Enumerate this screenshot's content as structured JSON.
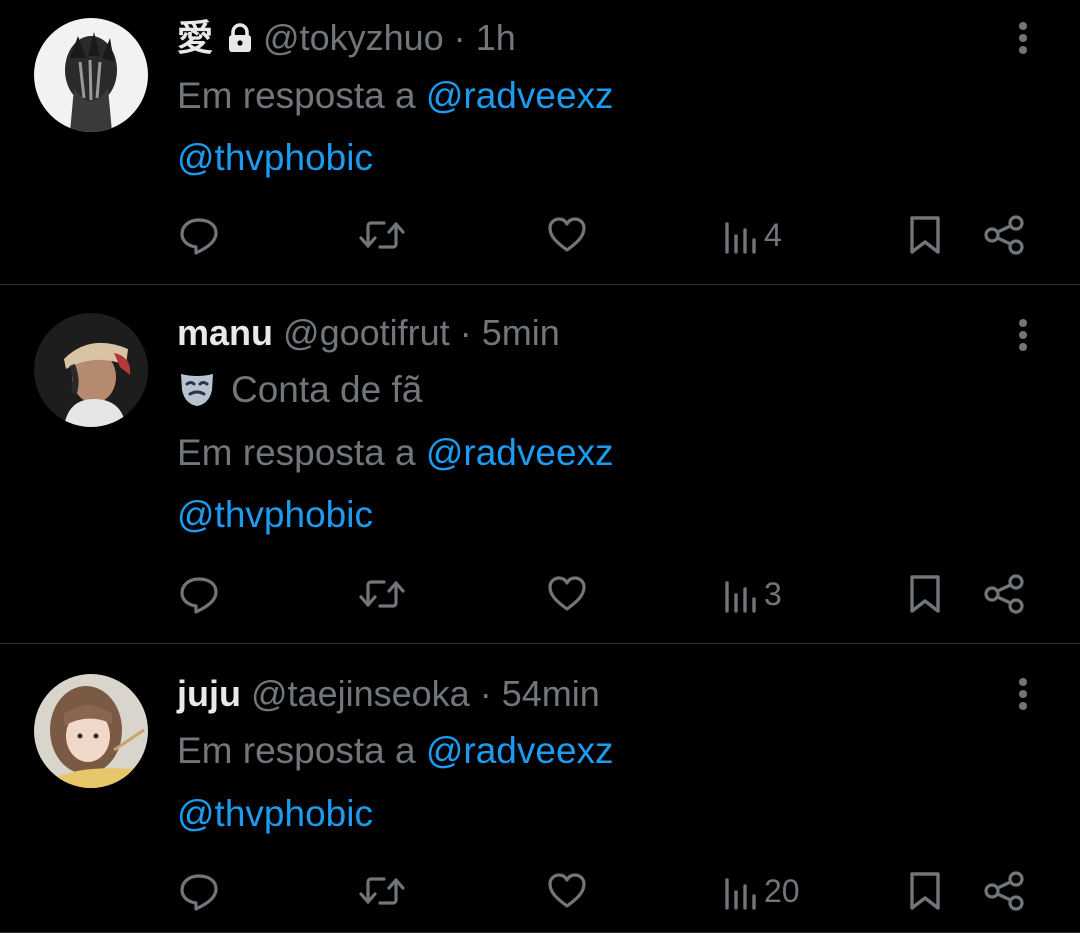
{
  "colors": {
    "background": "#000000",
    "text": "#e7e9ea",
    "muted": "#71767b",
    "link": "#1d9bf0",
    "divider": "#2f3336"
  },
  "reply_prefix": "Em resposta a",
  "tweets": [
    {
      "display_name": "愛",
      "protected": true,
      "handle": "@tokyzhuo",
      "separator": "·",
      "time": "1h",
      "badge": null,
      "reply_to": "@radveexz",
      "text": "@thvphobic",
      "views": "4",
      "icons": [
        "reply-icon",
        "retweet-icon",
        "like-icon",
        "views-icon",
        "bookmark-icon",
        "share-icon",
        "more-icon"
      ]
    },
    {
      "display_name": "manu",
      "protected": false,
      "handle": "@gootifrut",
      "separator": "·",
      "time": "5min",
      "badge": "Conta de fã",
      "reply_to": "@radveexz",
      "text": "@thvphobic",
      "views": "3",
      "icons": [
        "reply-icon",
        "retweet-icon",
        "like-icon",
        "views-icon",
        "bookmark-icon",
        "share-icon",
        "more-icon"
      ]
    },
    {
      "display_name": "juju",
      "protected": false,
      "handle": "@taejinseoka",
      "separator": "·",
      "time": "54min",
      "badge": null,
      "reply_to": "@radveexz",
      "text": "@thvphobic",
      "views": "20",
      "icons": [
        "reply-icon",
        "retweet-icon",
        "like-icon",
        "views-icon",
        "bookmark-icon",
        "share-icon",
        "more-icon"
      ]
    }
  ]
}
